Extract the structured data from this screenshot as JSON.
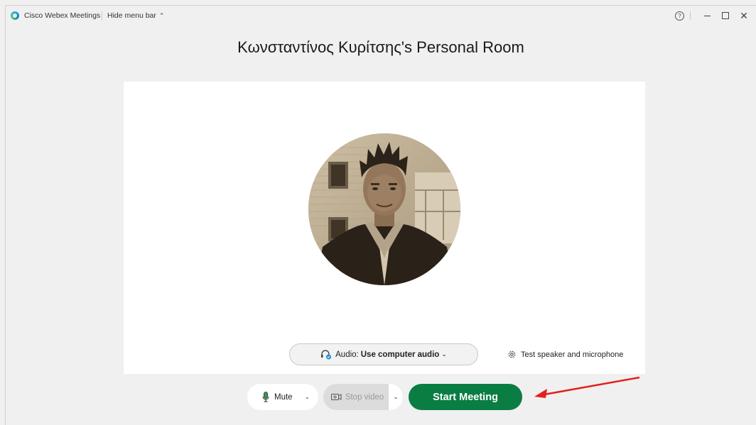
{
  "titlebar": {
    "app_name": "Cisco Webex Meetings",
    "hide_menu_label": "Hide menu bar",
    "help_glyph": "?"
  },
  "room": {
    "title": "Κωνσταντίνος Κυρίτσης's Personal Room"
  },
  "audio": {
    "label": "Audio:",
    "value": "Use computer audio"
  },
  "test_speaker_label": "Test speaker and microphone",
  "controls": {
    "mute_label": "Mute",
    "stop_video_label": "Stop video",
    "start_meeting_label": "Start Meeting"
  },
  "colors": {
    "start_button": "#0a7d43",
    "mic_active": "#2e9e4a",
    "annotation_arrow": "#e3201b",
    "headset_badge": "#1a8fd6"
  },
  "icons": {
    "app": "webex-logo-icon",
    "help": "help-circle-icon",
    "minimize": "minimize-icon",
    "maximize": "maximize-icon",
    "close": "close-icon",
    "audio": "headset-icon",
    "settings": "gear-icon",
    "mic": "microphone-icon",
    "video": "video-camera-icon"
  }
}
